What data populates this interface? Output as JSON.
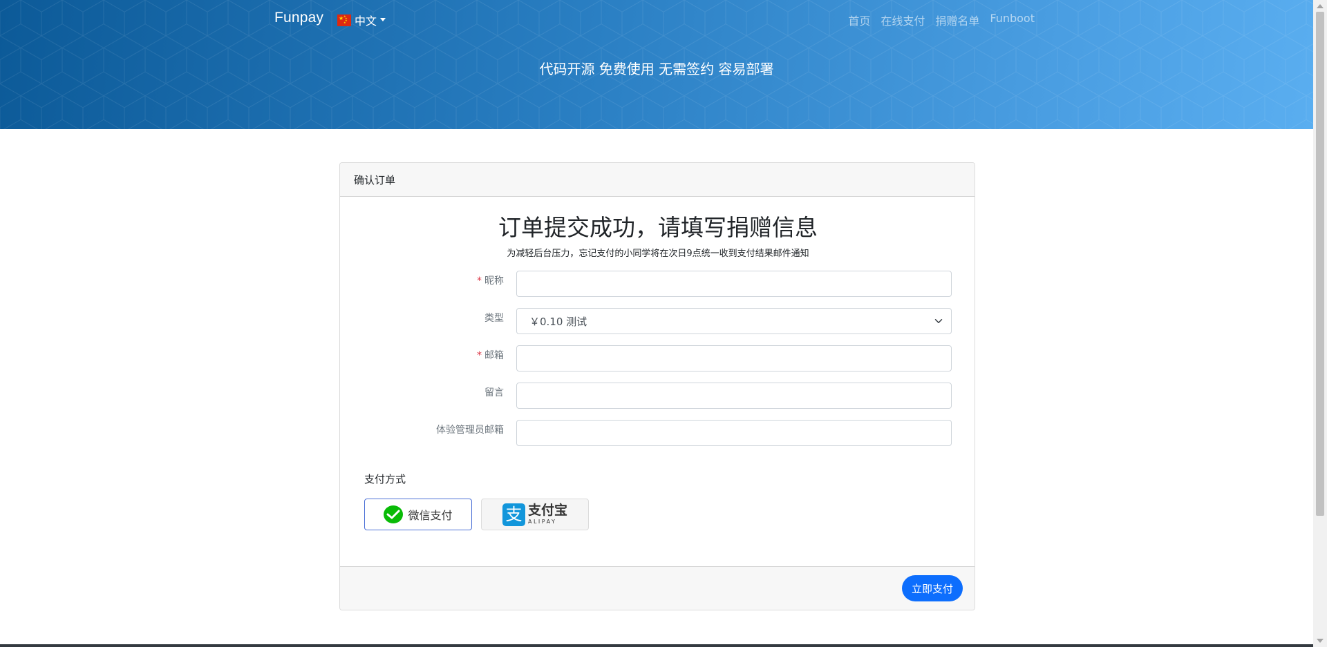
{
  "header": {
    "brand": "Funpay",
    "language": "中文",
    "nav": [
      "首页",
      "在线支付",
      "捐赠名单",
      "Funboot"
    ],
    "tagline": "代码开源 免费使用 无需签约 容易部署"
  },
  "card": {
    "header": "确认订单",
    "title": "订单提交成功，请填写捐赠信息",
    "subtitle": "为减轻后台压力，忘记支付的小同学将在次日9点统一收到支付结果邮件通知",
    "fields": {
      "nickname": {
        "label": "昵称",
        "required": true,
        "value": ""
      },
      "type": {
        "label": "类型",
        "value": "￥0.10 测试"
      },
      "email": {
        "label": "邮箱",
        "required": true,
        "value": ""
      },
      "message": {
        "label": "留言",
        "value": ""
      },
      "admin_email": {
        "label": "体验管理员邮箱",
        "value": ""
      }
    },
    "payment": {
      "label": "支付方式",
      "wechat": "微信支付",
      "alipay_cn": "支付宝",
      "alipay_en": "ALIPAY",
      "alipay_icon_char": "支",
      "selected": "wechat"
    },
    "submit": "立即支付"
  },
  "required_mark": "*",
  "colors": {
    "header_gradient_start": "#0c5a98",
    "header_gradient_end": "#5aaef0",
    "primary": "#0d6efd",
    "wechat_green": "#09bb07",
    "alipay_blue": "#1296db",
    "required_red": "#dc3545"
  },
  "icons": {
    "language_flag": "china-flag-icon",
    "language_caret": "caret-down-icon",
    "select_caret": "chevron-down-icon",
    "wechat": "wechat-icon",
    "alipay": "alipay-icon"
  }
}
